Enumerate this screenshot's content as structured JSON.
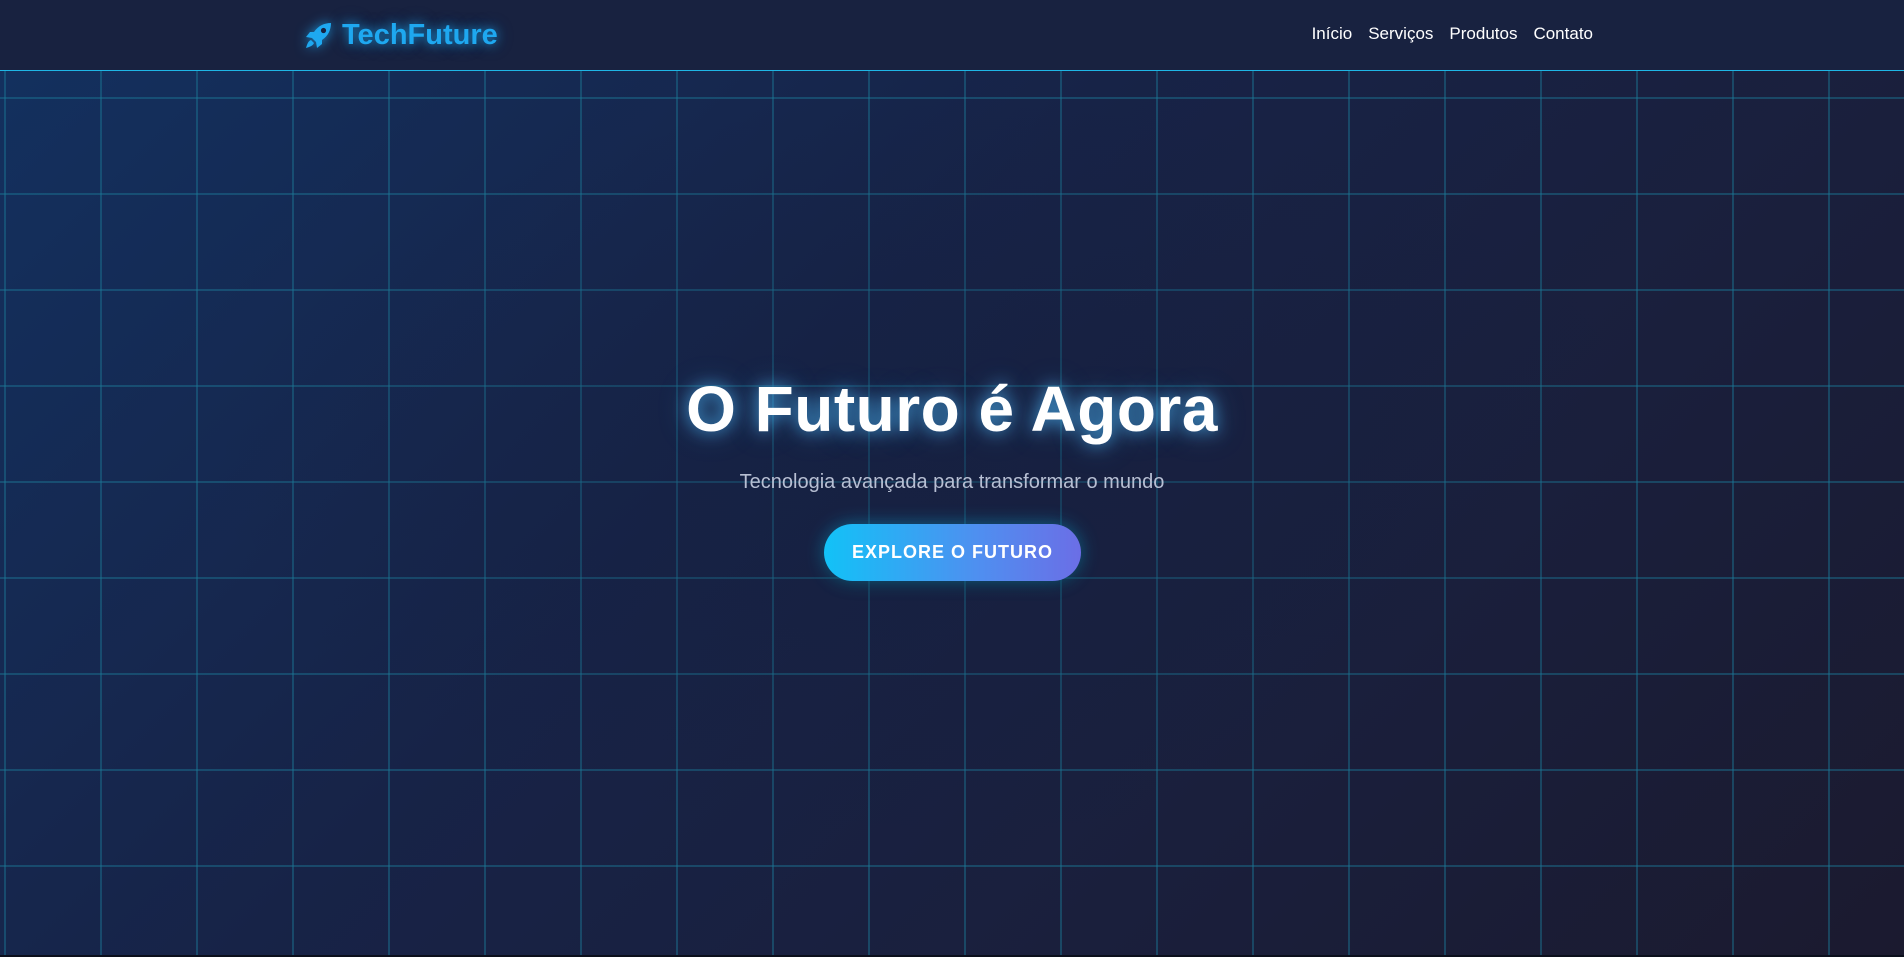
{
  "header": {
    "logo_icon": "rocket-icon",
    "logo_text": "TechFuture",
    "nav": [
      {
        "label": "Início"
      },
      {
        "label": "Serviços"
      },
      {
        "label": "Produtos"
      },
      {
        "label": "Contato"
      }
    ]
  },
  "hero": {
    "title": "O Futuro é Agora",
    "subtitle": "Tecnologia avançada para transformar o mundo",
    "cta_label": "EXPLORE O FUTURO"
  },
  "colors": {
    "accent": "#1ea8f0",
    "header_bg": "#182240",
    "cta_gradient_start": "#12c2f7",
    "cta_gradient_end": "#6b6ee6"
  }
}
